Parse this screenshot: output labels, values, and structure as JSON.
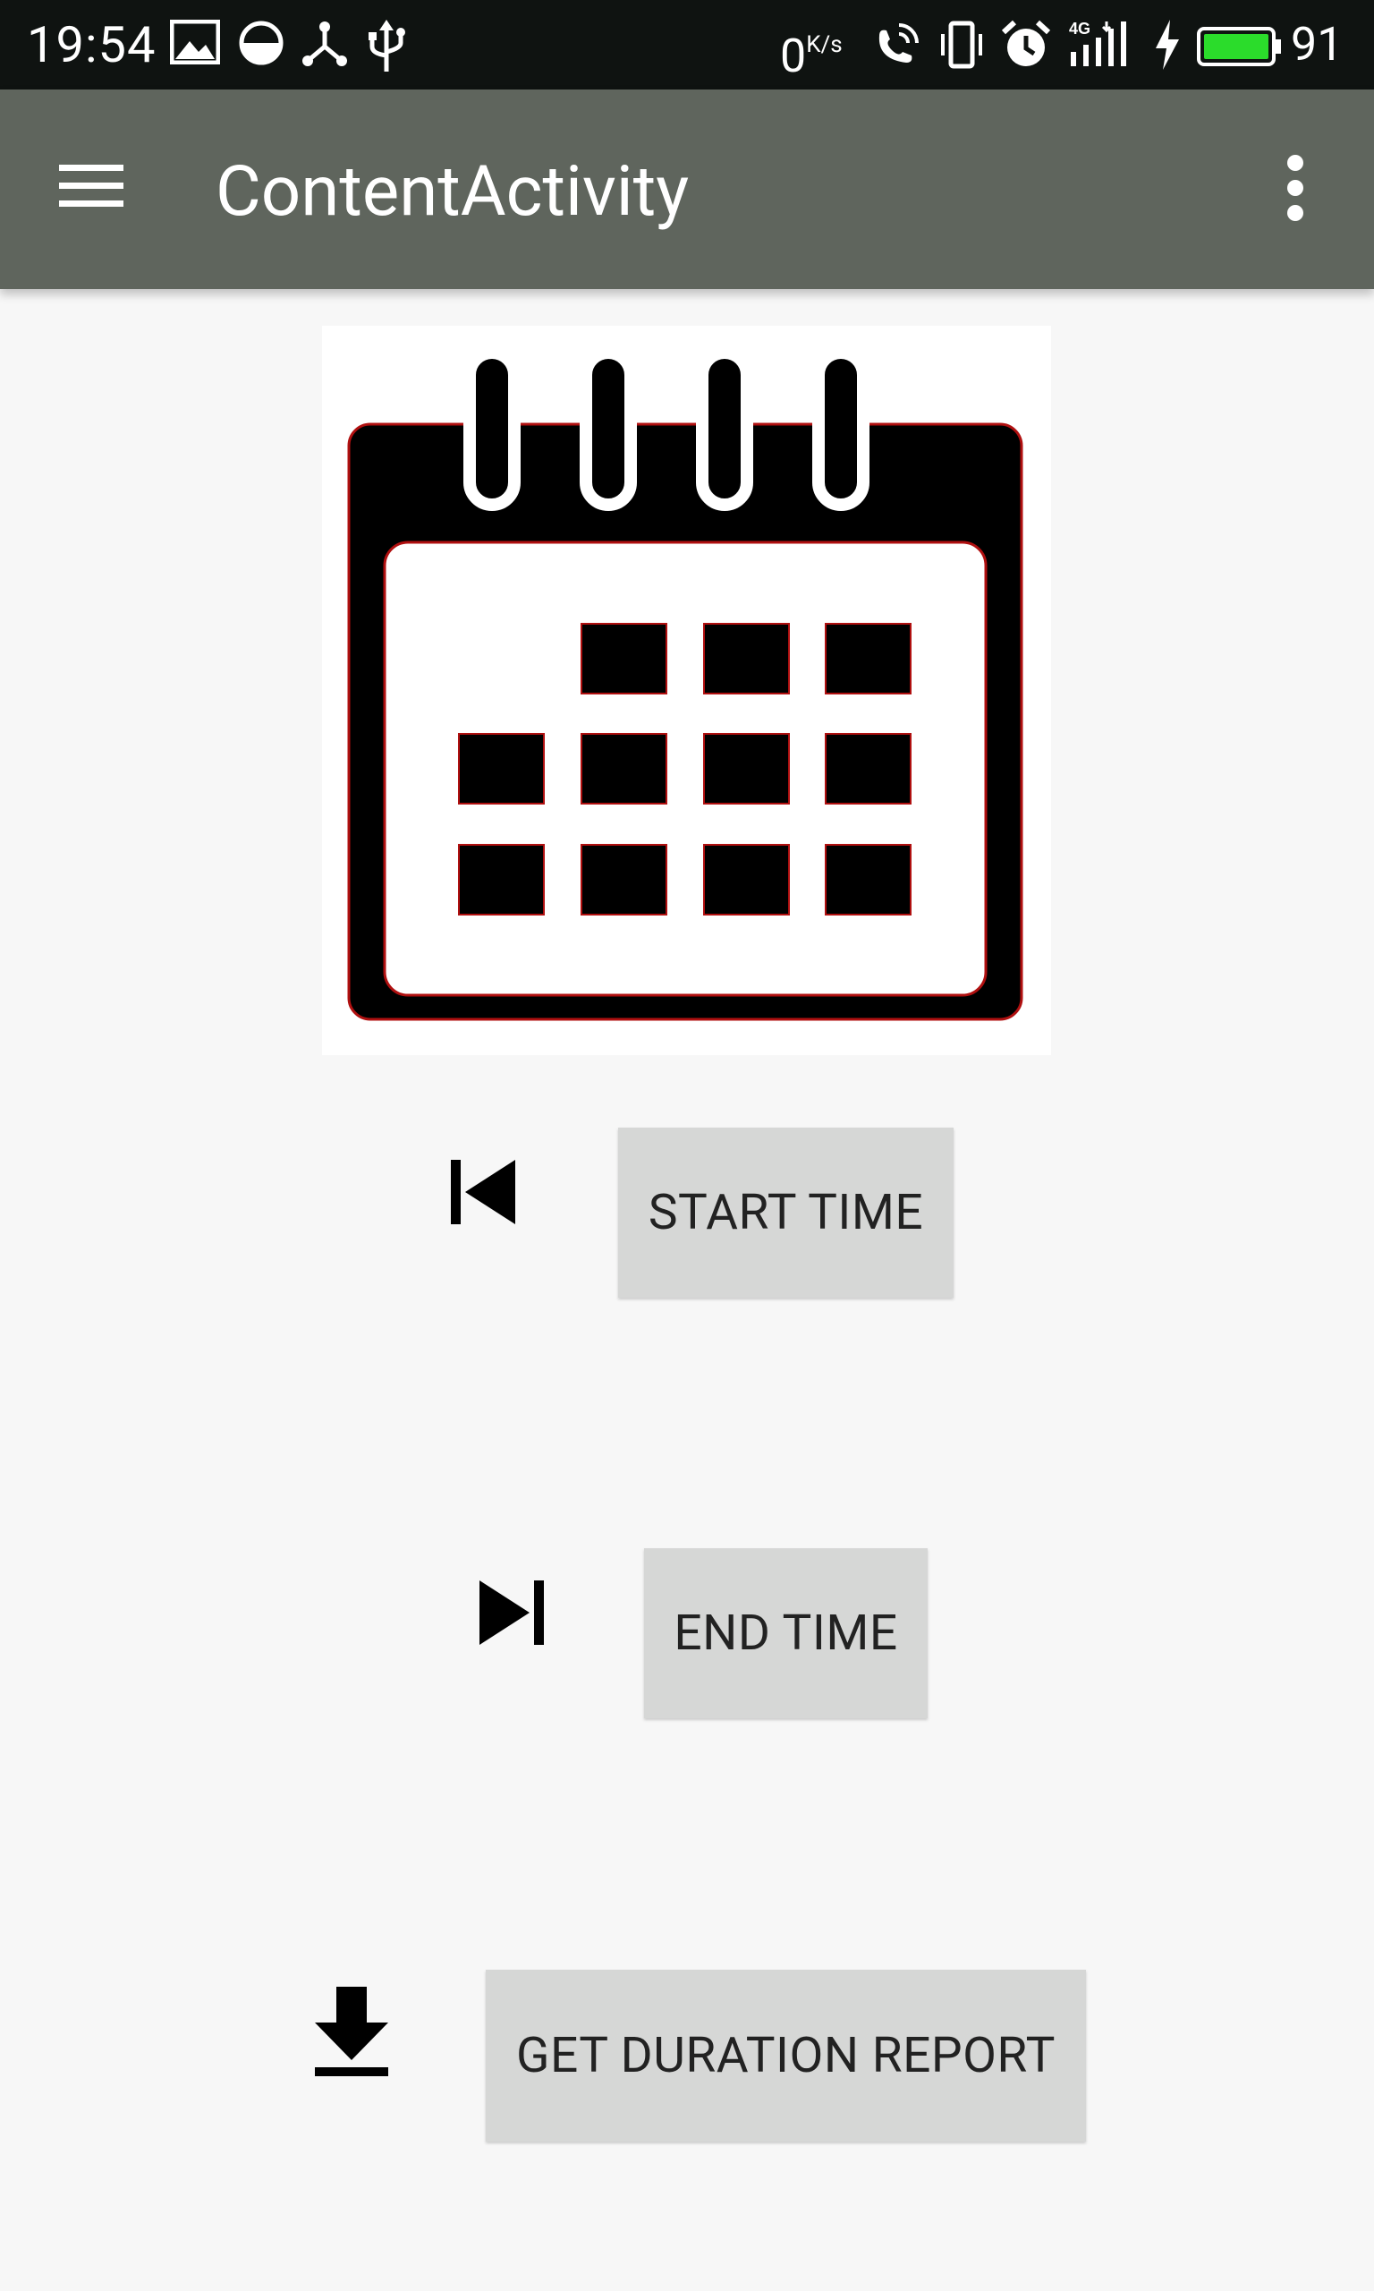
{
  "status_bar": {
    "time": "19:54",
    "speed_value": "0",
    "speed_unit": "K/s",
    "battery_level": "91",
    "battery_color": "#2bdc2b",
    "icons_left": [
      "image-icon",
      "data-saver-icon",
      "share-node-icon",
      "usb-icon"
    ],
    "icons_right": [
      "wifi-call-icon",
      "vibrate-icon",
      "alarm-icon",
      "signal-4g-icon",
      "charging-icon",
      "battery-icon"
    ]
  },
  "app_bar": {
    "title": "ContentActivity",
    "background": "#5f655d",
    "menu_icon": "hamburger-menu-icon",
    "overflow_icon": "more-vert-icon"
  },
  "hero": {
    "icon": "calendar-icon"
  },
  "actions": {
    "start_time": {
      "label": "START TIME",
      "icon": "skip-previous-icon"
    },
    "end_time": {
      "label": "END TIME",
      "icon": "skip-next-icon"
    },
    "report": {
      "label": "GET DURATION REPORT",
      "icon": "download-icon"
    }
  }
}
